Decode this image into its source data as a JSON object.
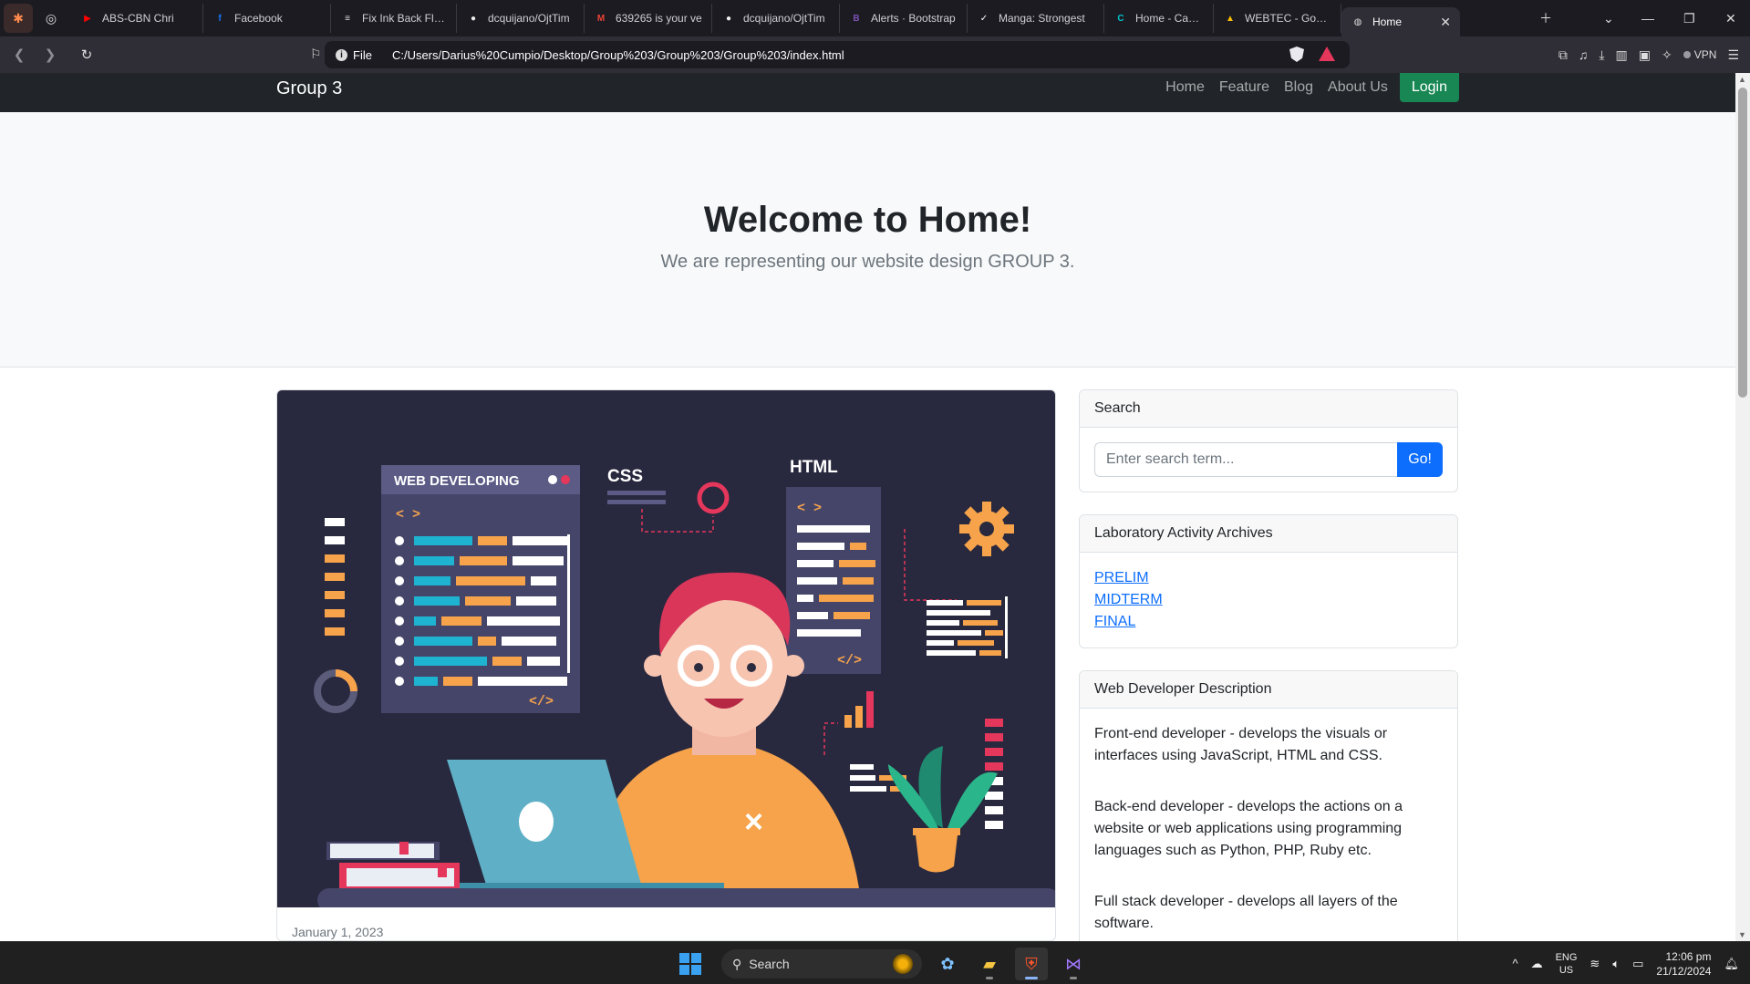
{
  "browser": {
    "tabs": [
      {
        "title": "ABS-CBN Chri",
        "icon": "youtube-icon",
        "color": "#ff0000"
      },
      {
        "title": "Facebook",
        "icon": "facebook-icon",
        "color": "#1877f2"
      },
      {
        "title": "Fix Ink Back Flow",
        "icon": "page-icon",
        "color": "#dddddd"
      },
      {
        "title": "dcquijano/OjtTim",
        "icon": "github-icon",
        "color": "#eeeeee"
      },
      {
        "title": "639265 is your ve",
        "icon": "gmail-icon",
        "color": "#ea4335"
      },
      {
        "title": "dcquijano/OjtTim",
        "icon": "github-icon",
        "color": "#eeeeee"
      },
      {
        "title": "Alerts · Bootstrap",
        "icon": "bootstrap-icon",
        "color": "#7952b3"
      },
      {
        "title": "Manga: Strongest",
        "icon": "manga-icon",
        "color": "#ffffff"
      },
      {
        "title": "Home - Canva",
        "icon": "canva-icon",
        "color": "#00c4cc"
      },
      {
        "title": "WEBTEC - Google",
        "icon": "drive-icon",
        "color": "#fbbc04"
      }
    ],
    "active_tab": "Home",
    "url_scheme": "File",
    "url": "C:/Users/Darius%20Cumpio/Desktop/Group%203/Group%203/Group%203/index.html",
    "vpn_label": "VPN"
  },
  "site": {
    "brand": "Group 3",
    "nav": [
      "Home",
      "Feature",
      "Blog",
      "About Us"
    ],
    "login_label": "Login",
    "hero_title": "Welcome to Home!",
    "hero_subtitle": "We are representing our website design GROUP 3.",
    "post_date": "January 1, 2023",
    "illustration": {
      "web_developing": "WEB DEVELOPING",
      "css": "CSS",
      "html": "HTML"
    },
    "search": {
      "heading": "Search",
      "placeholder": "Enter search term...",
      "button": "Go!"
    },
    "archives": {
      "heading": "Laboratory Activity Archives",
      "links": [
        "PRELIM",
        "MIDTERM",
        "FINAL"
      ]
    },
    "description": {
      "heading": "Web Developer Description",
      "items": [
        "Front-end developer - develops the visuals or interfaces using JavaScript, HTML and CSS.",
        "Back-end developer - develops the actions on a website or web applications using programming languages such as Python, PHP, Ruby etc.",
        "Full stack developer - develops all layers of the software."
      ]
    }
  },
  "taskbar": {
    "search_label": "Search",
    "lang_line1": "ENG",
    "lang_line2": "US",
    "time": "12:06 pm",
    "date": "21/12/2024"
  }
}
